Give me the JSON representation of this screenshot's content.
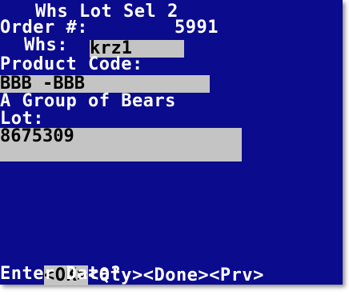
{
  "screen": {
    "title": "Whs Lot Sel 2",
    "order_label": "Order #:",
    "order_value": "5991",
    "whs_label": "Whs:",
    "whs_value": "krz1",
    "product_code_label": "Product Code:",
    "product_code_value": "BBB -BBB",
    "product_description": "A Group of Bears",
    "lot_label": "Lot:",
    "lot_value": "8675309",
    "menu": [
      {
        "label": "<OK>",
        "selected": true
      },
      {
        "label": "<Qty>",
        "selected": false
      },
      {
        "label": "<Done>",
        "selected": false
      },
      {
        "label": "<Prv>",
        "selected": false
      }
    ],
    "prompt": "Enter Data?"
  },
  "colors": {
    "background": "#0b0b8e",
    "text": "#ffffff",
    "field_background": "#c4c4c4",
    "field_text": "#000000"
  }
}
